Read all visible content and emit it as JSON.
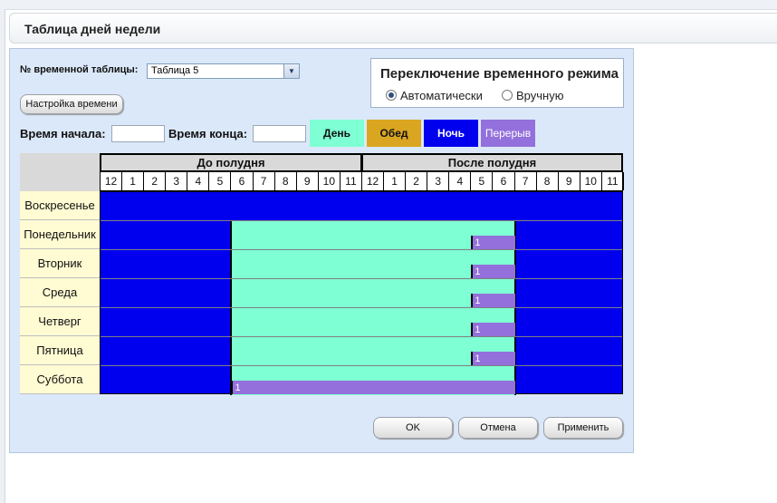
{
  "page": {
    "title": "Таблица дней недели"
  },
  "form": {
    "table_no_label": "№ временной таблицы:",
    "table_select_value": "Таблица 5",
    "time_settings_button": "Настройка времени",
    "start_time_label": "Время начала:",
    "end_time_label": "Время конца:"
  },
  "mode": {
    "title": "Переключение временного режима",
    "options": [
      {
        "label": "Автоматически",
        "selected": true
      },
      {
        "label": "Вручную",
        "selected": false
      }
    ]
  },
  "legend": [
    {
      "label": "День",
      "color": "#7fffd4"
    },
    {
      "label": "Обед",
      "color": "#daa520"
    },
    {
      "label": "Ночь",
      "color": "#0000ee"
    },
    {
      "label": "Перерыв",
      "color": "#9370db"
    }
  ],
  "schedule": {
    "halves": [
      "До полудня",
      "После полудня"
    ],
    "hours": [
      "12",
      "1",
      "2",
      "3",
      "4",
      "5",
      "6",
      "7",
      "8",
      "9",
      "10",
      "11",
      "12",
      "1",
      "2",
      "3",
      "4",
      "5",
      "6",
      "7",
      "8",
      "9",
      "10",
      "11"
    ],
    "break_label": "1",
    "days": [
      {
        "name": "Воскресенье",
        "day_from": null,
        "day_to": null,
        "break_from": null,
        "break_to": null
      },
      {
        "name": "Понедельник",
        "day_from": 6,
        "day_to": 19,
        "break_from": 17,
        "break_to": 19
      },
      {
        "name": "Вторник",
        "day_from": 6,
        "day_to": 19,
        "break_from": 17,
        "break_to": 19
      },
      {
        "name": "Среда",
        "day_from": 6,
        "day_to": 19,
        "break_from": 17,
        "break_to": 19
      },
      {
        "name": "Четверг",
        "day_from": 6,
        "day_to": 19,
        "break_from": 17,
        "break_to": 19
      },
      {
        "name": "Пятница",
        "day_from": 6,
        "day_to": 19,
        "break_from": 17,
        "break_to": 19
      },
      {
        "name": "Суббота",
        "day_from": 6,
        "day_to": 19,
        "break_from": 6,
        "break_to": 19
      }
    ]
  },
  "buttons": {
    "ok": "OK",
    "cancel": "Отмена",
    "apply": "Применить"
  }
}
